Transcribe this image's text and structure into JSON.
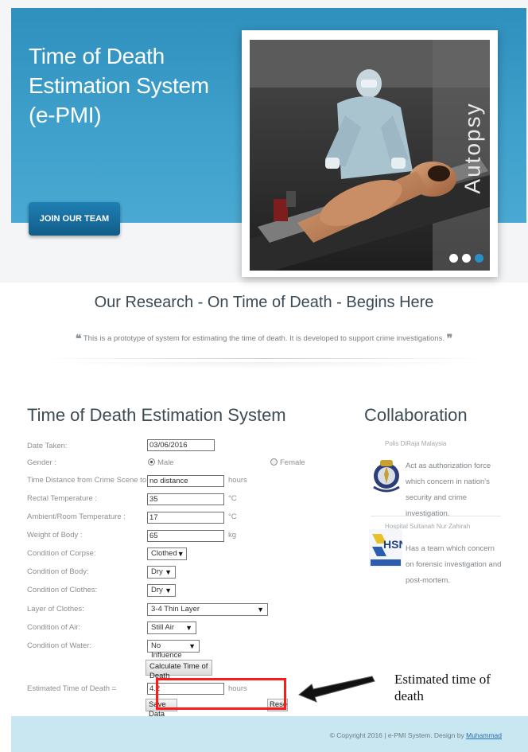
{
  "hero": {
    "title_line1": "Time of Death",
    "title_line2": "Estimation System",
    "title_line3": "(e-PMI)",
    "join_button": "JOIN OUR TEAM",
    "slide_label": "Autopsy",
    "slide_count": 3,
    "active_slide": 3
  },
  "research": {
    "title": "Our Research - On Time of Death - Begins Here",
    "quote": "This is a prototype of system for estimating the time of death. It is developed to support crime investigations.",
    "quote_open": "❝",
    "quote_close": "❞"
  },
  "form": {
    "title": "Time of Death Estimation System",
    "date_label": "Date Taken:",
    "date_value": "03/06/2016",
    "gender_label": "Gender :",
    "gender_male": "Male",
    "gender_female": "Female",
    "gender_selected": "Male",
    "distance_label": "Time Distance from Crime Scene to Hospital:",
    "distance_value": "no distance",
    "distance_unit": "hours",
    "rectal_label": "Rectal Temperature :",
    "rectal_value": "35",
    "rectal_unit": "°C",
    "ambient_label": "Ambient/Room Temperature :",
    "ambient_value": "17",
    "ambient_unit": "°C",
    "weight_label": "Weight of Body :",
    "weight_value": "65",
    "weight_unit": "kg",
    "corpse_label": "Condition of Corpse:",
    "corpse_value": "Clothed",
    "body_label": "Condition of Body:",
    "body_value": "Dry",
    "clothes_label": "Condition of Clothes:",
    "clothes_value": "Dry",
    "layer_label": "Layer of Clothes:",
    "layer_value": "3-4 Thin Layer",
    "air_label": "Condition of Air:",
    "air_value": "Still Air",
    "water_label": "Condition of Water:",
    "water_value": "No Influence",
    "calc_button": "Calculate Time of Death",
    "estimated_label": "Estimated Time of Death =",
    "estimated_value": "4.2",
    "estimated_unit": "hours",
    "save_button": "Save Data",
    "reset_button": "Reset"
  },
  "collaboration": {
    "title": "Collaboration",
    "items": [
      {
        "source": "Polis DiRaja Malaysia",
        "desc": "Act as authorization force which concern in nation's security and crime investigation."
      },
      {
        "source": "Hospital Sultanah Nur Zahirah",
        "desc": "Has a team which concern on forensic investigation and post-mortem."
      }
    ],
    "hsnz_logo_text": "HSNZ"
  },
  "annotation": {
    "label": "Estimated time of death"
  },
  "footer": {
    "copyright": "© Copyright 2016 | e-PMI System. Design by",
    "designer": "Muhammad"
  },
  "colors": {
    "hero_blue": "#3ea0cb",
    "button_blue": "#125d8a",
    "annotation_red": "#ff1a1a",
    "footer_bg": "#c8e7f0"
  }
}
